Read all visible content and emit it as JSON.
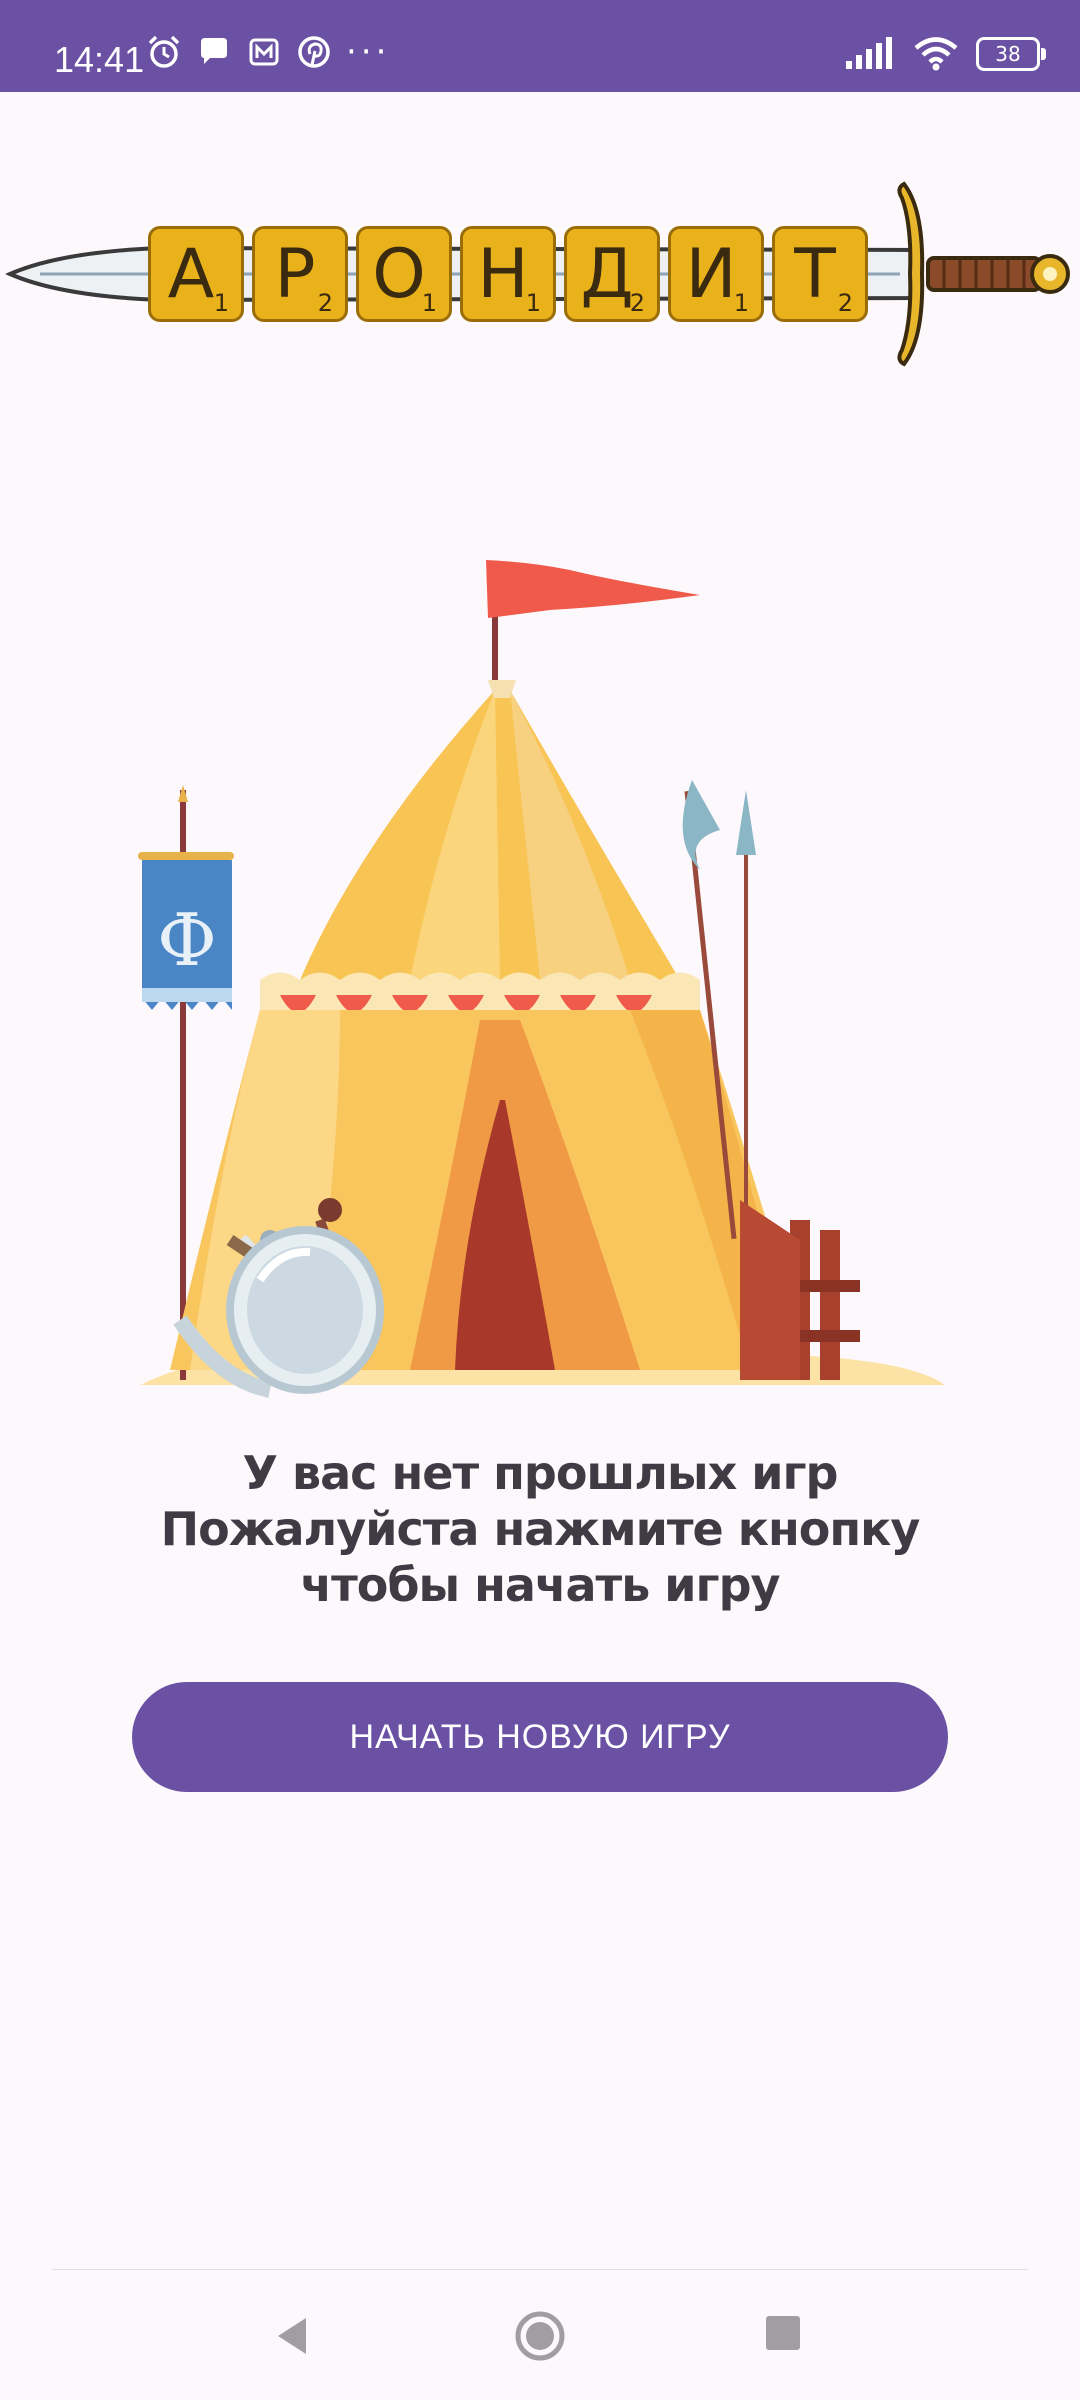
{
  "status_bar": {
    "time": "14:41",
    "left_icons": [
      "alarm-icon",
      "chat-icon",
      "mail-icon",
      "pinterest-icon"
    ],
    "overflow": "···",
    "right_icons": [
      "signal-icon",
      "wifi-icon",
      "battery-icon"
    ],
    "battery_level": "38"
  },
  "logo": {
    "tiles": [
      {
        "letter": "А",
        "score": "1"
      },
      {
        "letter": "Р",
        "score": "2"
      },
      {
        "letter": "О",
        "score": "1"
      },
      {
        "letter": "Н",
        "score": "1"
      },
      {
        "letter": "Д",
        "score": "2"
      },
      {
        "letter": "И",
        "score": "1"
      },
      {
        "letter": "Т",
        "score": "2"
      }
    ]
  },
  "illustration": {
    "banner_letter": "Ф"
  },
  "message": {
    "line1": "У вас нет прошлых игр",
    "line2": "Пожалуйста нажмите кнопку чтобы начать игру"
  },
  "start_button": {
    "label": "НАЧАТЬ НОВУЮ ИГРУ"
  },
  "nav": {
    "buttons": [
      "back-icon",
      "home-icon",
      "recents-icon"
    ]
  }
}
